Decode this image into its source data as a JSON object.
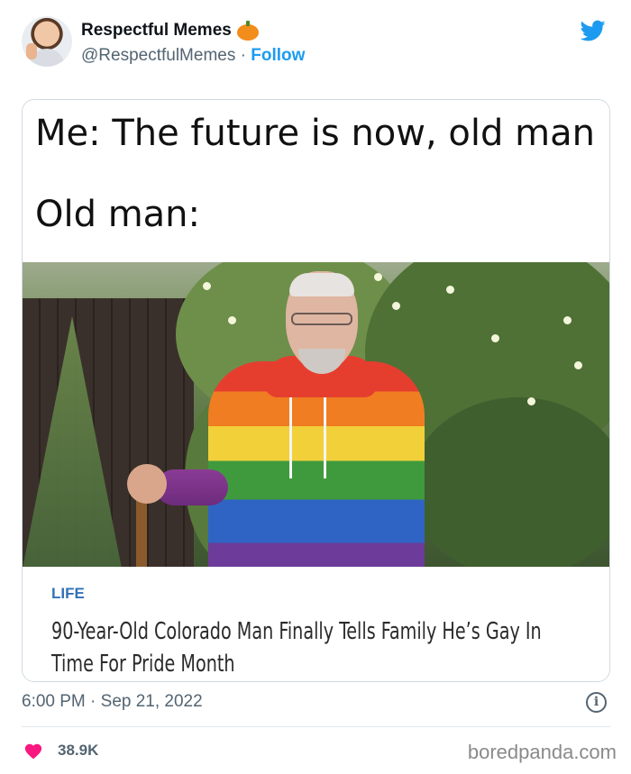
{
  "author": {
    "display_name": "Respectful Memes",
    "handle": "@RespectfulMemes",
    "separator": "·",
    "follow_label": "Follow"
  },
  "icons": {
    "badge": "pumpkin-emoji-icon",
    "brand": "twitter-bird-icon",
    "info": "info-icon",
    "like": "heart-icon"
  },
  "meme": {
    "line1": "Me: The future is now, old man",
    "line2": "Old man:"
  },
  "article": {
    "section": "LIFE",
    "headline": "90-Year-Old Colorado Man Finally Tells Family He’s Gay In Time For Pride Month"
  },
  "footer": {
    "timestamp": "6:00 PM · Sep 21, 2022",
    "likes": "38.9K",
    "watermark": "boredpanda.com"
  },
  "colors": {
    "accent": "#1d9bf0",
    "like": "#f91880",
    "section": "#3271b7"
  }
}
